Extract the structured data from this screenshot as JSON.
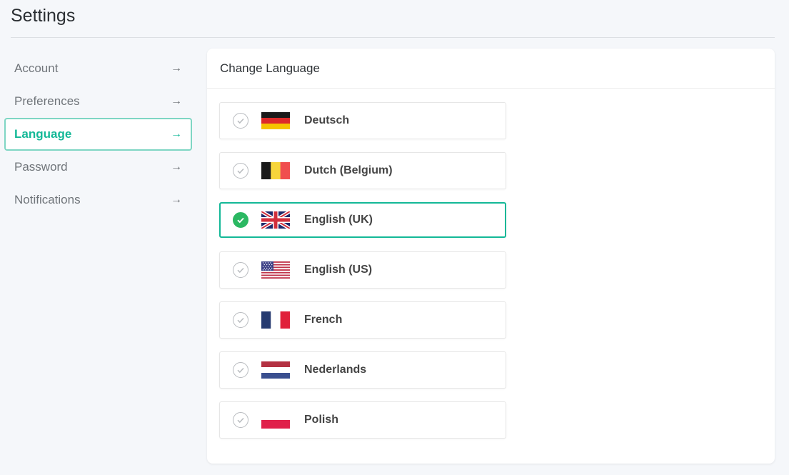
{
  "page": {
    "title": "Settings"
  },
  "sidebar": {
    "items": [
      {
        "label": "Account",
        "active": false
      },
      {
        "label": "Preferences",
        "active": false
      },
      {
        "label": "Language",
        "active": true
      },
      {
        "label": "Password",
        "active": false
      },
      {
        "label": "Notifications",
        "active": false
      }
    ]
  },
  "card": {
    "title": "Change Language",
    "languages": [
      {
        "label": "Deutsch",
        "flag": "flag-de",
        "selected": false
      },
      {
        "label": "Dutch (Belgium)",
        "flag": "flag-be",
        "selected": false
      },
      {
        "label": "English (UK)",
        "flag": "flag-uk",
        "selected": true
      },
      {
        "label": "English (US)",
        "flag": "flag-us",
        "selected": false
      },
      {
        "label": "French",
        "flag": "flag-fr",
        "selected": false
      },
      {
        "label": "Nederlands",
        "flag": "flag-nl",
        "selected": false
      },
      {
        "label": "Polish",
        "flag": "flag-pl",
        "selected": false
      }
    ]
  },
  "colors": {
    "accent": "#13b897",
    "check_selected": "#2bb862",
    "background": "#f5f7fa"
  }
}
